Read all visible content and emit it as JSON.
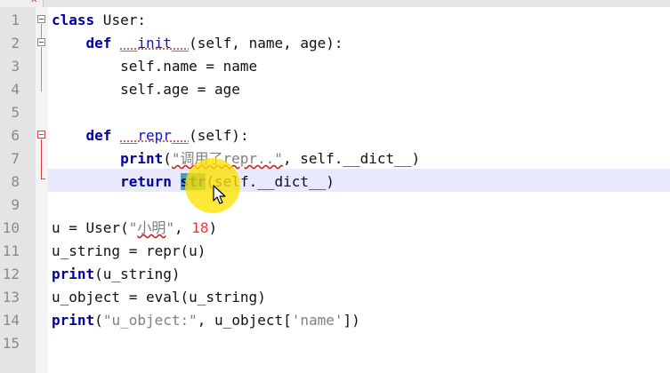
{
  "editor": {
    "line_numbers": [
      "1",
      "2",
      "3",
      "4",
      "5",
      "6",
      "7",
      "8",
      "9",
      "10",
      "11",
      "12",
      "13",
      "14",
      "15"
    ],
    "current_line": "8",
    "code": {
      "l1": {
        "kw": "class",
        "rest": " User:"
      },
      "l2": {
        "indent": "    ",
        "kw": "def",
        "sp": " ",
        "dunder": "__init__",
        "rest": "(self, name, age):"
      },
      "l3": {
        "indent": "        ",
        "rest": "self.name = name"
      },
      "l4": {
        "indent": "        ",
        "rest": "self.age = age"
      },
      "l6": {
        "indent": "    ",
        "kw": "def",
        "sp": " ",
        "dunder": "__repr__",
        "rest": "(self):"
      },
      "l7": {
        "indent": "        ",
        "kw": "print",
        "paren": "(",
        "str": "\"调用了repr..\"",
        "rest": ", self.__dict__)"
      },
      "l8": {
        "indent": "        ",
        "kw": "return",
        "sp": " ",
        "sel": "str",
        "rest": "(self.__dict__)"
      },
      "l10": {
        "pre": "u = User(",
        "str_q1": "\"",
        "str_u": "小明",
        "str_q2": "\"",
        "mid": ", ",
        "num": "18",
        "end": ")"
      },
      "l11": {
        "rest": "u_string = repr(u)"
      },
      "l12": {
        "kw": "print",
        "rest": "(u_string)"
      },
      "l13": {
        "rest": "u_object = eval(u_string)"
      },
      "l14": {
        "kw": "print",
        "paren": "(",
        "str": "\"u_object:\"",
        "mid": ", u_object[",
        "str2": "'name'",
        "end": "])"
      }
    }
  },
  "colors": {
    "keyword": "#0000a0",
    "string": "#808080",
    "number": "#ff3030",
    "selection": "#3fa8a8",
    "current_line": "#e8e8ff",
    "click_highlight": "#ffe100"
  },
  "icons": [
    "tab-close-icon",
    "fold-toggle-icon",
    "mouse-pointer-icon"
  ]
}
